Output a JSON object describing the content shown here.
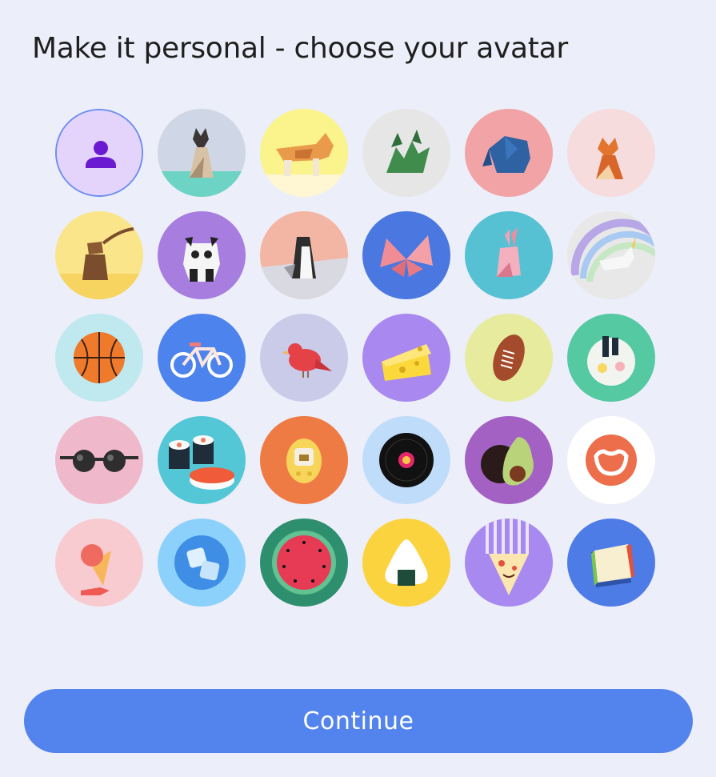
{
  "header": {
    "title": "Make it personal - choose your avatar"
  },
  "avatars": [
    {
      "name": "default-person-icon",
      "bg": "#e4d4fb",
      "selected": true
    },
    {
      "name": "origami-cat-icon",
      "bg": "#cfd6e6"
    },
    {
      "name": "origami-corgi-icon",
      "bg": "#fbf38c"
    },
    {
      "name": "origami-dragon-icon",
      "bg": "#e6e6e6"
    },
    {
      "name": "origami-elephant-icon",
      "bg": "#f2a3a6"
    },
    {
      "name": "origami-fox-icon",
      "bg": "#f6dcdc"
    },
    {
      "name": "origami-monkey-icon",
      "bg": "#fbe58a"
    },
    {
      "name": "origami-panda-icon",
      "bg": "#a77de0"
    },
    {
      "name": "origami-penguin-icon",
      "bg": "#f3b6a4"
    },
    {
      "name": "origami-butterfly-icon",
      "bg": "#4a78e0"
    },
    {
      "name": "origami-rabbit-icon",
      "bg": "#55c1d3"
    },
    {
      "name": "origami-unicorn-icon",
      "bg": "#e8e8e8"
    },
    {
      "name": "basketball-icon",
      "bg": "#bfe9ef"
    },
    {
      "name": "bicycle-icon",
      "bg": "#4d83ec"
    },
    {
      "name": "bird-icon",
      "bg": "#c9cbe8"
    },
    {
      "name": "cheese-icon",
      "bg": "#a988ef"
    },
    {
      "name": "football-icon",
      "bg": "#e6eb9e"
    },
    {
      "name": "ramen-icon",
      "bg": "#55c9a2"
    },
    {
      "name": "sunglasses-icon",
      "bg": "#f0b8cb"
    },
    {
      "name": "sushi-icon",
      "bg": "#53c7d6"
    },
    {
      "name": "handheld-game-icon",
      "bg": "#ee7a44"
    },
    {
      "name": "vinyl-record-icon",
      "bg": "#bfdcfb"
    },
    {
      "name": "avocado-icon",
      "bg": "#a361c3"
    },
    {
      "name": "smile-logo-icon",
      "bg": "#ffffff"
    },
    {
      "name": "ice-cream-icon",
      "bg": "#f8cbd1"
    },
    {
      "name": "ice-cubes-icon",
      "bg": "#8bd1fb"
    },
    {
      "name": "watermelon-icon",
      "bg": "#2e8f6f"
    },
    {
      "name": "onigiri-icon",
      "bg": "#fbd33f"
    },
    {
      "name": "pizza-icon",
      "bg": "#a889f0"
    },
    {
      "name": "sandwich-icon",
      "bg": "#4e7ce6"
    }
  ],
  "actions": {
    "continue_label": "Continue"
  }
}
